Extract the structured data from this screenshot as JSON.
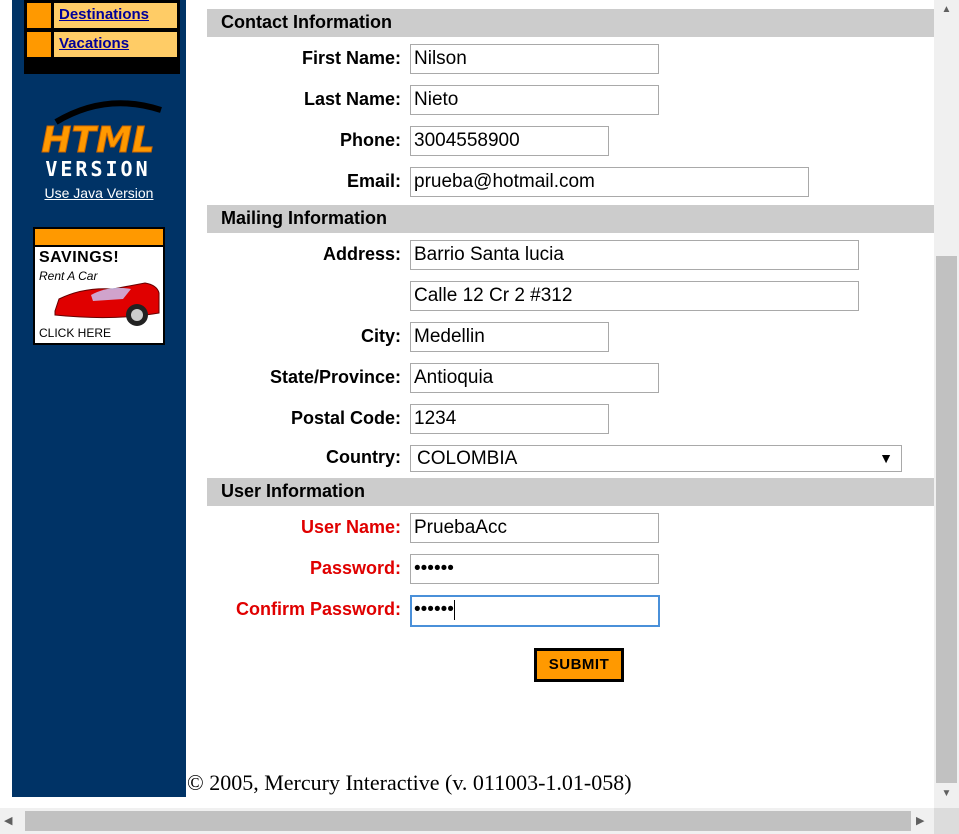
{
  "sidebar": {
    "nav_items": [
      "Destinations",
      "Vacations"
    ],
    "logo_top": "HTML",
    "logo_bottom": "VERSION",
    "java_link": "Use Java Version",
    "ad": {
      "line1": "SAVINGS!",
      "line2": "Rent A Car",
      "line3": "CLICK HERE"
    }
  },
  "contact": {
    "title": "Contact Information",
    "first_name_label": "First Name:",
    "first_name": "Nilson",
    "last_name_label": "Last Name:",
    "last_name": "Nieto",
    "phone_label": "Phone:",
    "phone": "3004558900",
    "email_label": "Email:",
    "email": "prueba@hotmail.com"
  },
  "mailing": {
    "title": "Mailing Information",
    "address_label": "Address:",
    "address1": "Barrio Santa lucia",
    "address2": "Calle 12 Cr 2 #312",
    "city_label": "City:",
    "city": "Medellin",
    "state_label": "State/Province:",
    "state": "Antioquia",
    "postal_label": "Postal Code:",
    "postal": "1234",
    "country_label": "Country:",
    "country": "COLOMBIA"
  },
  "user": {
    "title": "User Information",
    "username_label": "User Name:",
    "username": "PruebaAcc",
    "password_label": "Password:",
    "password": "••••••",
    "confirm_label": "Confirm Password:",
    "confirm": "••••••"
  },
  "submit_label": "SUBMIT",
  "footer": "© 2005, Mercury Interactive (v. 011003-1.01-058)",
  "colors": {
    "sidebar": "#003366",
    "accent": "#ff9900",
    "required": "#e00000",
    "section": "#cccccc"
  }
}
